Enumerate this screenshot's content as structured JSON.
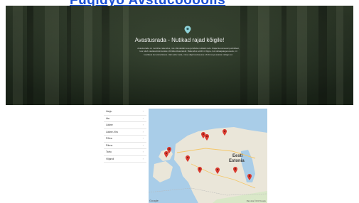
{
  "top_link": "Fuqidyo Avstucoooolis",
  "hero": {
    "title": "Avastusrada - Nutikad rajad kõigile!",
    "body": "Avastusrada on mobiilne rakendus, mis võimaldab luua ja läbida nutikaid radu. Rajad koosnevad punktidest, kus tuleb vastata küsimustele või täita ülesandeid. Rakendus sobib nii õppe- kui vabaajategevuseks, nii koolidele kui ettevõtetele. Vali sobiv rada, mine välja loodusesse või linna ja avasta midagi uut."
  },
  "regions": [
    "Harju",
    "Ida",
    "Lääne",
    "Lääne-Viru",
    "Põlva",
    "Pärnu",
    "Tartu",
    "Viljandi"
  ],
  "map": {
    "label_et": "Eesti",
    "label_en": "Estonia",
    "credit": "Google",
    "terms": "Map data ©2015 Google",
    "marker_color": "#d93a2f"
  }
}
